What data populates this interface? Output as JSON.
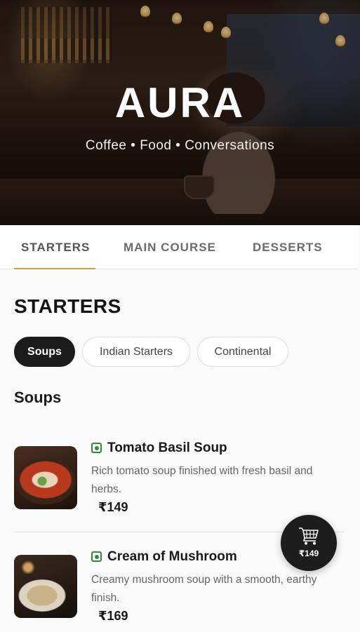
{
  "hero": {
    "title": "AURA",
    "tagline": "Coffee • Food • Conversations"
  },
  "tabs": [
    {
      "label": "STARTERS",
      "active": true
    },
    {
      "label": "MAIN COURSE",
      "active": false
    },
    {
      "label": "DESSERTS",
      "active": false
    }
  ],
  "section": {
    "title": "STARTERS",
    "chips": [
      {
        "label": "Soups",
        "active": true
      },
      {
        "label": "Indian Starters",
        "active": false
      },
      {
        "label": "Continental",
        "active": false
      }
    ],
    "subsection_title": "Soups"
  },
  "items": [
    {
      "name": "Tomato Basil Soup",
      "desc_line1": "Rich tomato soup finished with fresh basil and",
      "desc_line2": "herbs.",
      "price": "₹149",
      "veg": true
    },
    {
      "name": "Cream of Mushroom",
      "desc_line1": "Creamy mushroom soup with a smooth, earthy",
      "desc_line2": "finish.",
      "price": "₹169",
      "veg": true
    }
  ],
  "cart": {
    "total": "₹149",
    "icon": "shopping-cart-icon"
  },
  "colors": {
    "accent": "#d99a3f",
    "veg_green": "#2e8b3a",
    "dark": "#1c1c1c"
  }
}
